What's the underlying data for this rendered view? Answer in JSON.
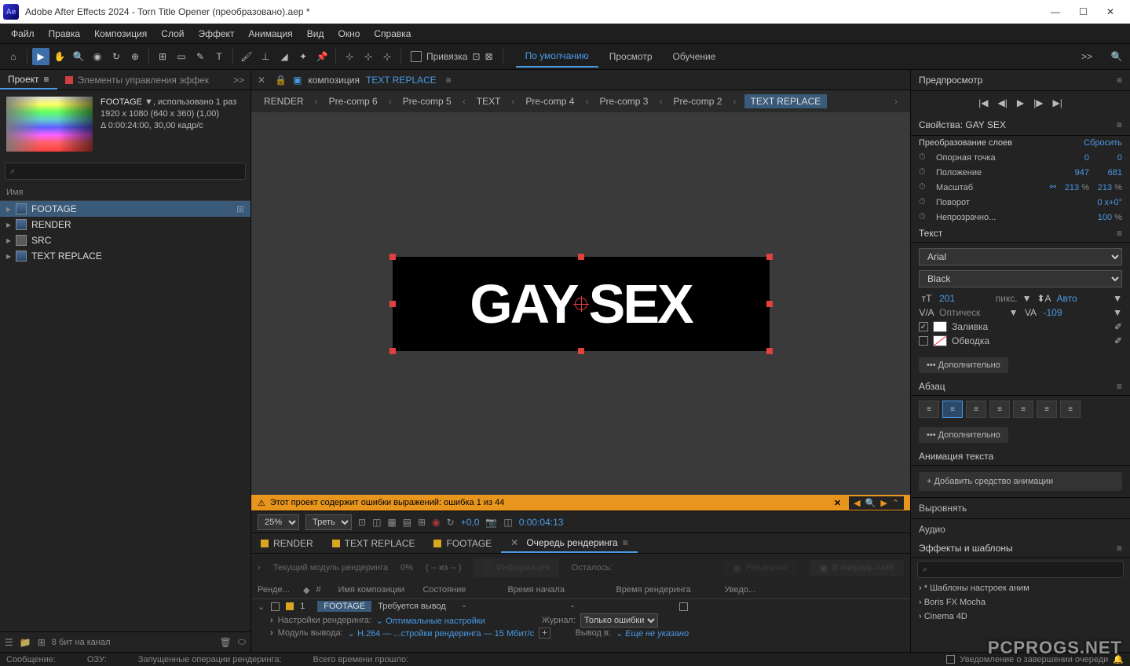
{
  "titlebar": {
    "title": "Adobe After Effects 2024 - Torn Title Opener (преобразовано).aep *"
  },
  "menubar": [
    "Файл",
    "Правка",
    "Композиция",
    "Слой",
    "Эффект",
    "Анимация",
    "Вид",
    "Окно",
    "Справка"
  ],
  "toolbar": {
    "snap_label": "Привязка",
    "workspaces": [
      "По умолчанию",
      "Просмотр",
      "Обучение"
    ],
    "more_label": ">>"
  },
  "project_panel": {
    "tabs": {
      "project": "Проект",
      "effect_controls": "Элементы управления эффек"
    },
    "more": ">>",
    "item_name": "FOOTAGE",
    "item_used": ", использовано 1 раз",
    "resolution": "1920 x 1080   (640 x 360) (1,00)",
    "duration": "Δ 0:00:24:00, 30,00 кадр/с",
    "search_placeholder": "⌕",
    "tree_header": "Имя",
    "items": [
      "FOOTAGE",
      "RENDER",
      "SRC",
      "TEXT REPLACE"
    ],
    "bits_label": "8 бит на канал"
  },
  "composition": {
    "tab_label": "композиция",
    "tab_name": "TEXT REPLACE",
    "breadcrumb": [
      "RENDER",
      "Pre-comp 6",
      "Pre-comp 5",
      "TEXT",
      "Pre-comp 4",
      "Pre-comp 3",
      "Pre-comp 2",
      "TEXT REPLACE"
    ],
    "canvas_text": "GAY SEX",
    "error_text": "Этот проект содержит ошибки выражений: ошибка 1 из 44",
    "zoom": "25%",
    "resolution_mode": "Треть",
    "exposure": "+0,0",
    "timecode": "0:00:04:13"
  },
  "render_queue": {
    "tabs": [
      "RENDER",
      "TEXT REPLACE",
      "FOOTAGE",
      "Очередь рендеринга"
    ],
    "progress_label": "Текущий модуль рендеринга",
    "progress_pct": "0%",
    "progress_count": "( -- из -- )",
    "info_btn": "Информация",
    "remaining": "Осталось:",
    "render_btn": "Рендеринг",
    "ame_btn": "В очередь AME",
    "headers": {
      "render": "Ренде...",
      "num": "#",
      "comp": "Имя композиции",
      "status": "Состояние",
      "start": "Время начала",
      "dur": "Время рендеринга",
      "notif": "Уведо..."
    },
    "row": {
      "num": "1",
      "comp": "FOOTAGE",
      "status": "Требуется вывод",
      "dash": "-"
    },
    "settings_label": "Настройки рендеринга:",
    "settings_value": "Оптимальные настройки",
    "output_module_label": "Модуль вывода:",
    "output_module_value": "H.264 — ...стройки рендеринга — 15 Мбит/с",
    "log_label": "Журнал:",
    "log_value": "Только ошибки",
    "output_to_label": "Вывод в:",
    "output_to_value": "Еще не указано"
  },
  "preview": {
    "title": "Предпросмотр"
  },
  "properties": {
    "title": "Свойства: GAY SEX",
    "transform_title": "Преобразование слоев",
    "reset": "Сбросить",
    "anchor": {
      "label": "Опорная точка",
      "x": "0",
      "y": "0"
    },
    "position": {
      "label": "Положение",
      "x": "947",
      "y": "681"
    },
    "scale": {
      "label": "Масштаб",
      "x": "213",
      "y": "213",
      "unit": "%"
    },
    "rotation": {
      "label": "Поворот",
      "value": "0 x+0°"
    },
    "opacity": {
      "label": "Непрозрачно...",
      "value": "100",
      "unit": "%"
    }
  },
  "text_panel": {
    "title": "Текст",
    "font": "Arial",
    "style": "Black",
    "size": "201",
    "size_unit": "пикс.",
    "leading": "Авто",
    "kerning": "Оптическ",
    "tracking": "-109",
    "fill_label": "Заливка",
    "stroke_label": "Обводка",
    "more": "••• Дополнительно"
  },
  "paragraph": {
    "title": "Абзац",
    "more": "••• Дополнительно"
  },
  "text_anim": {
    "title": "Анимация текста",
    "add_btn": "+ Добавить средство анимации"
  },
  "align": {
    "title": "Выровнять"
  },
  "audio": {
    "title": "Аудио"
  },
  "effects": {
    "title": "Эффекты и шаблоны",
    "items": [
      "* Шаблоны настроек аним",
      "Boris FX Mocha",
      "Cinema 4D"
    ]
  },
  "statusbar": {
    "message": "Сообщение:",
    "ram": "ОЗУ:",
    "running": "Запущенные операции рендеринга:",
    "elapsed": "Всего времени прошло:",
    "notif": "Уведомление о завершении очереди"
  },
  "watermark": "PCPROGS.NET"
}
